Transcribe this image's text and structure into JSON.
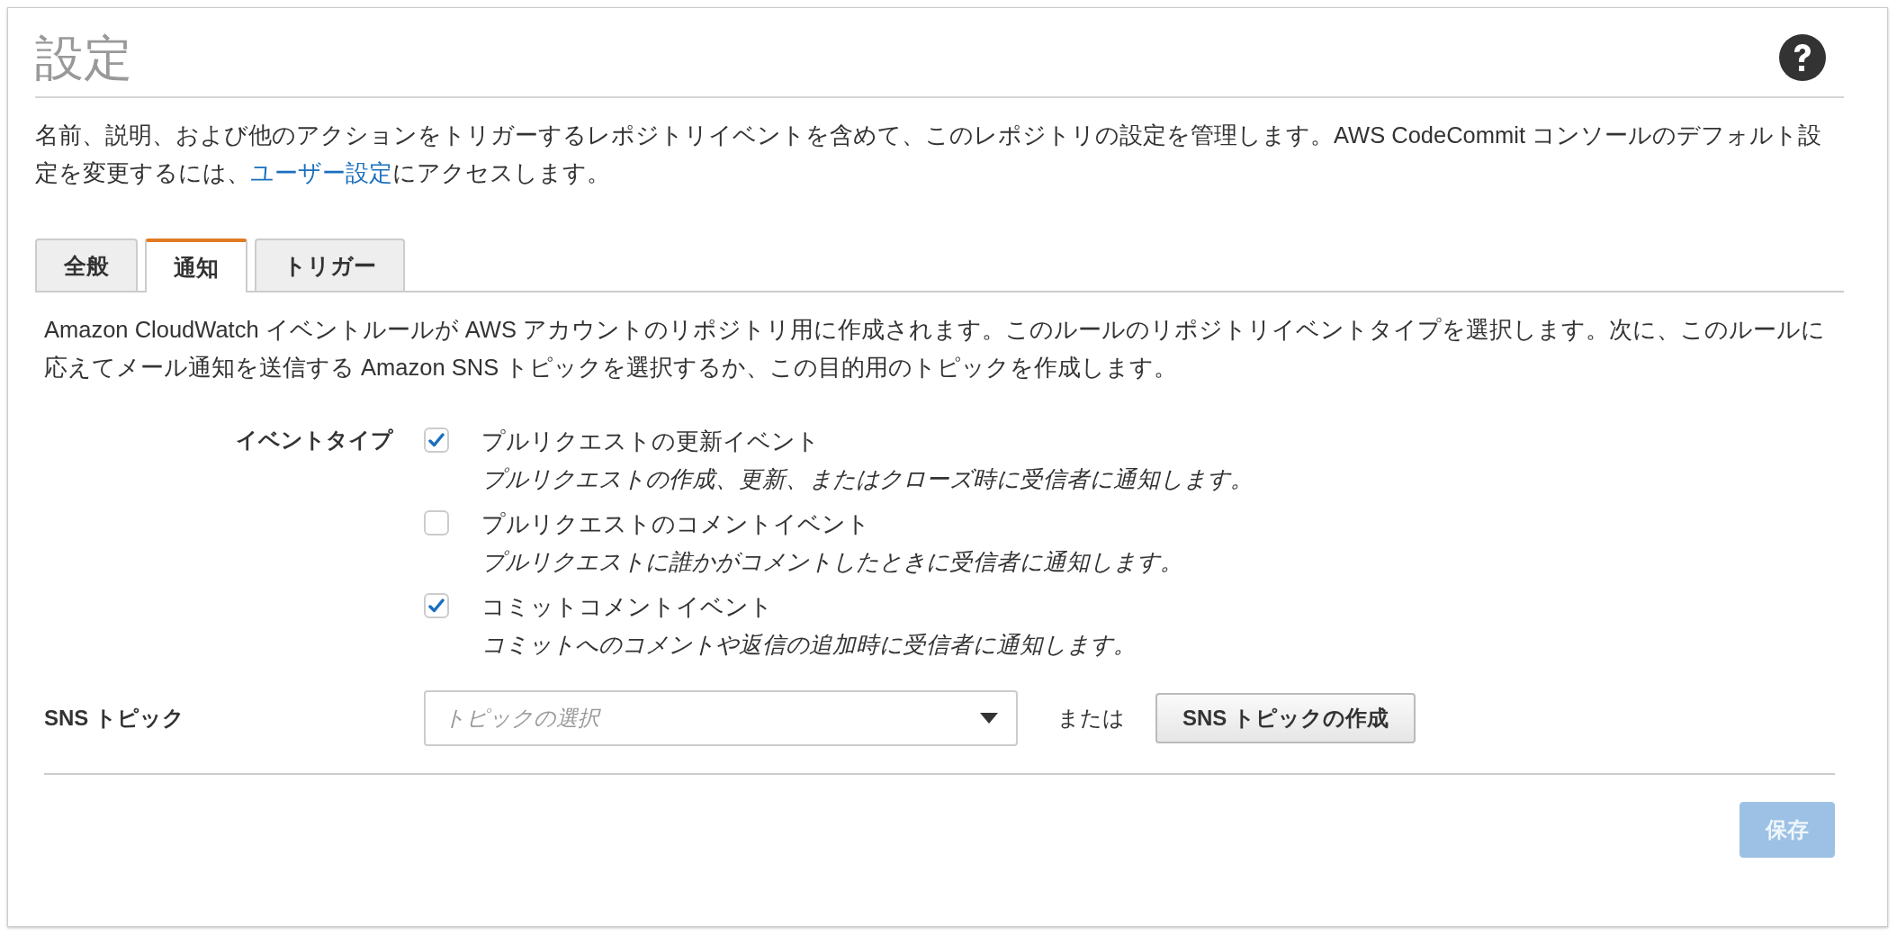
{
  "header": {
    "title": "設定"
  },
  "description": {
    "before": "名前、説明、および他のアクションをトリガーするレポジトリイベントを含めて、このレポジトリの設定を管理します。AWS CodeCommit コンソールのデフォルト設定を変更するには、",
    "link": "ユーザー設定",
    "after": "にアクセスします。"
  },
  "tabs": [
    {
      "label": "全般",
      "selected": false
    },
    {
      "label": "通知",
      "selected": true
    },
    {
      "label": "トリガー",
      "selected": false
    }
  ],
  "intro": "Amazon CloudWatch イベントルールが AWS アカウントのリポジトリ用に作成されます。このルールのリポジトリイベントタイプを選択します。次に、このルールに応えてメール通知を送信する Amazon SNS トピックを選択するか、この目的用のトピックを作成します。",
  "event_type": {
    "label": "イベントタイプ",
    "options": [
      {
        "label": "プルリクエストの更新イベント",
        "hint": "プルリクエストの作成、更新、またはクローズ時に受信者に通知します。",
        "checked": true
      },
      {
        "label": "プルリクエストのコメントイベント",
        "hint": "プルリクエストに誰かがコメントしたときに受信者に通知します。",
        "checked": false
      },
      {
        "label": "コミットコメントイベント",
        "hint": "コミットへのコメントや返信の追加時に受信者に通知します。",
        "checked": true
      }
    ]
  },
  "sns_topic": {
    "label": "SNS トピック",
    "placeholder": "トピックの選択",
    "or": "または",
    "create_button": "SNS トピックの作成"
  },
  "save_button": {
    "label": "保存",
    "disabled": true
  }
}
